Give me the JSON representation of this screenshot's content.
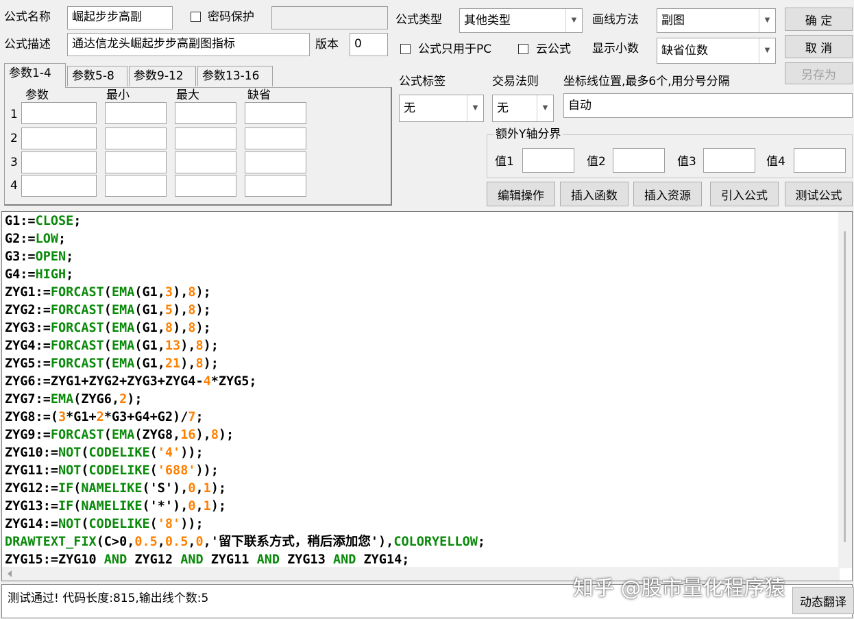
{
  "form": {
    "name_label": "公式名称",
    "name_value": "崛起步步高副",
    "password_label": "密码保护",
    "desc_label": "公式描述",
    "desc_value": "通达信龙头崛起步步高副图指标",
    "version_label": "版本",
    "version_value": "0",
    "type_label": "公式类型",
    "type_value": "其他类型",
    "draw_label": "画线方法",
    "draw_value": "副图",
    "pc_only_label": "公式只用于PC",
    "cloud_label": "云公式",
    "decimals_label": "显示小数",
    "decimals_value": "缺省位数",
    "tag_label": "公式标签",
    "tag_value": "无",
    "rule_label": "交易法则",
    "rule_value": "无",
    "axis_label": "坐标线位置,最多6个,用分号分隔",
    "axis_value": "自动",
    "yaxis_group_label": "额外Y轴分界",
    "y1": "值1",
    "y2": "值2",
    "y3": "值3",
    "y4": "值4"
  },
  "buttons": {
    "ok": "确 定",
    "cancel": "取 消",
    "save_as": "另存为",
    "edit": "编辑操作",
    "insert_func": "插入函数",
    "insert_res": "插入资源",
    "import": "引入公式",
    "test": "测试公式",
    "translate": "动态翻译"
  },
  "tabs": [
    "参数1-4",
    "参数5-8",
    "参数9-12",
    "参数13-16"
  ],
  "params": {
    "headers": [
      "参数",
      "最小",
      "最大",
      "缺省"
    ],
    "rows": [
      "1",
      "2",
      "3",
      "4"
    ]
  },
  "code_lines": [
    [
      [
        "v",
        "G1:="
      ],
      [
        "k",
        "CLOSE"
      ],
      [
        "v",
        ";"
      ]
    ],
    [
      [
        "v",
        "G2:="
      ],
      [
        "k",
        "LOW"
      ],
      [
        "v",
        ";"
      ]
    ],
    [
      [
        "v",
        "G3:="
      ],
      [
        "k",
        "OPEN"
      ],
      [
        "v",
        ";"
      ]
    ],
    [
      [
        "v",
        "G4:="
      ],
      [
        "k",
        "HIGH"
      ],
      [
        "v",
        ";"
      ]
    ],
    [
      [
        "v",
        "ZYG1:="
      ],
      [
        "k",
        "FORCAST"
      ],
      [
        "v",
        "("
      ],
      [
        "k",
        "EMA"
      ],
      [
        "v",
        "(G1,"
      ],
      [
        "n",
        "3"
      ],
      [
        "v",
        "),"
      ],
      [
        "n",
        "8"
      ],
      [
        "v",
        ");"
      ]
    ],
    [
      [
        "v",
        "ZYG2:="
      ],
      [
        "k",
        "FORCAST"
      ],
      [
        "v",
        "("
      ],
      [
        "k",
        "EMA"
      ],
      [
        "v",
        "(G1,"
      ],
      [
        "n",
        "5"
      ],
      [
        "v",
        "),"
      ],
      [
        "n",
        "8"
      ],
      [
        "v",
        ");"
      ]
    ],
    [
      [
        "v",
        "ZYG3:="
      ],
      [
        "k",
        "FORCAST"
      ],
      [
        "v",
        "("
      ],
      [
        "k",
        "EMA"
      ],
      [
        "v",
        "(G1,"
      ],
      [
        "n",
        "8"
      ],
      [
        "v",
        "),"
      ],
      [
        "n",
        "8"
      ],
      [
        "v",
        ");"
      ]
    ],
    [
      [
        "v",
        "ZYG4:="
      ],
      [
        "k",
        "FORCAST"
      ],
      [
        "v",
        "("
      ],
      [
        "k",
        "EMA"
      ],
      [
        "v",
        "(G1,"
      ],
      [
        "n",
        "13"
      ],
      [
        "v",
        "),"
      ],
      [
        "n",
        "8"
      ],
      [
        "v",
        ");"
      ]
    ],
    [
      [
        "v",
        "ZYG5:="
      ],
      [
        "k",
        "FORCAST"
      ],
      [
        "v",
        "("
      ],
      [
        "k",
        "EMA"
      ],
      [
        "v",
        "(G1,"
      ],
      [
        "n",
        "21"
      ],
      [
        "v",
        "),"
      ],
      [
        "n",
        "8"
      ],
      [
        "v",
        ");"
      ]
    ],
    [
      [
        "v",
        "ZYG6:=ZYG1+ZYG2+ZYG3+ZYG4-"
      ],
      [
        "n",
        "4"
      ],
      [
        "v",
        "*ZYG5;"
      ]
    ],
    [
      [
        "v",
        "ZYG7:="
      ],
      [
        "k",
        "EMA"
      ],
      [
        "v",
        "(ZYG6,"
      ],
      [
        "n",
        "2"
      ],
      [
        "v",
        ");"
      ]
    ],
    [
      [
        "v",
        "ZYG8:=("
      ],
      [
        "n",
        "3"
      ],
      [
        "v",
        "*G1+"
      ],
      [
        "n",
        "2"
      ],
      [
        "v",
        "*G3+G4+G2)/"
      ],
      [
        "n",
        "7"
      ],
      [
        "v",
        ";"
      ]
    ],
    [
      [
        "v",
        "ZYG9:="
      ],
      [
        "k",
        "FORCAST"
      ],
      [
        "v",
        "("
      ],
      [
        "k",
        "EMA"
      ],
      [
        "v",
        "(ZYG8,"
      ],
      [
        "n",
        "16"
      ],
      [
        "v",
        "),"
      ],
      [
        "n",
        "8"
      ],
      [
        "v",
        ");"
      ]
    ],
    [
      [
        "v",
        "ZYG10:="
      ],
      [
        "k",
        "NOT"
      ],
      [
        "v",
        "("
      ],
      [
        "k",
        "CODELIKE"
      ],
      [
        "v",
        "("
      ],
      [
        "n",
        "'4'"
      ],
      [
        "v",
        "));"
      ]
    ],
    [
      [
        "v",
        "ZYG11:="
      ],
      [
        "k",
        "NOT"
      ],
      [
        "v",
        "("
      ],
      [
        "k",
        "CODELIKE"
      ],
      [
        "v",
        "("
      ],
      [
        "n",
        "'688'"
      ],
      [
        "v",
        "));"
      ]
    ],
    [
      [
        "v",
        "ZYG12:="
      ],
      [
        "k",
        "IF"
      ],
      [
        "v",
        "("
      ],
      [
        "k",
        "NAMELIKE"
      ],
      [
        "v",
        "('S'),"
      ],
      [
        "n",
        "0"
      ],
      [
        "v",
        ","
      ],
      [
        "n",
        "1"
      ],
      [
        "v",
        ");"
      ]
    ],
    [
      [
        "v",
        "ZYG13:="
      ],
      [
        "k",
        "IF"
      ],
      [
        "v",
        "("
      ],
      [
        "k",
        "NAMELIKE"
      ],
      [
        "v",
        "('*'),"
      ],
      [
        "n",
        "0"
      ],
      [
        "v",
        ","
      ],
      [
        "n",
        "1"
      ],
      [
        "v",
        ");"
      ]
    ],
    [
      [
        "v",
        "ZYG14:="
      ],
      [
        "k",
        "NOT"
      ],
      [
        "v",
        "("
      ],
      [
        "k",
        "CODELIKE"
      ],
      [
        "v",
        "("
      ],
      [
        "n",
        "'8'"
      ],
      [
        "v",
        "));"
      ]
    ],
    [
      [
        "k",
        "DRAWTEXT_FIX"
      ],
      [
        "v",
        "(C>0,"
      ],
      [
        "n",
        "0.5"
      ],
      [
        "v",
        ","
      ],
      [
        "n",
        "0.5"
      ],
      [
        "v",
        ","
      ],
      [
        "n",
        "0"
      ],
      [
        "v",
        ",'留下联系方式，稍后添加您'),"
      ],
      [
        "k",
        "COLORYELLOW"
      ],
      [
        "v",
        ";"
      ]
    ],
    [
      [
        "v",
        "ZYG15:=ZYG10 "
      ],
      [
        "k",
        "AND"
      ],
      [
        "v",
        " ZYG12 "
      ],
      [
        "k",
        "AND"
      ],
      [
        "v",
        " ZYG11 "
      ],
      [
        "k",
        "AND"
      ],
      [
        "v",
        " ZYG13 "
      ],
      [
        "k",
        "AND"
      ],
      [
        "v",
        " ZYG14;"
      ]
    ]
  ],
  "status_text": "测试通过! 代码长度:815,输出线个数:5",
  "watermark": "知乎 @股市量化程序猿"
}
